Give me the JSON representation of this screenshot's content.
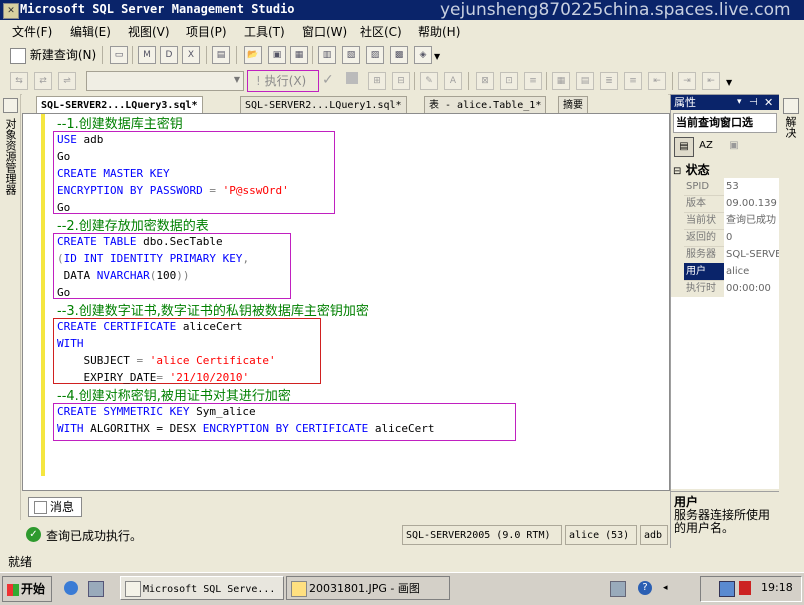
{
  "window": {
    "title": "Microsoft SQL Server Management Studio",
    "watermark": "yejunsheng870225china.spaces.live.com"
  },
  "menu": [
    "文件(F)",
    "编辑(E)",
    "视图(V)",
    "项目(P)",
    "工具(T)",
    "窗口(W)",
    "社区(C)",
    "帮助(H)"
  ],
  "toolbar": {
    "new_query_label": "新建查询(N)",
    "execute_label": "执行(X)"
  },
  "object_explorer_label": "对象资源管理器",
  "tabs": [
    {
      "label": "SQL-SERVER2...LQuery3.sql*"
    },
    {
      "label": "SQL-SERVER2...LQuery1.sql*"
    },
    {
      "label": "表 - alice.Table_1*"
    },
    {
      "label": "摘要"
    }
  ],
  "code": {
    "c1": "--1.创建数据库主密钥",
    "l1a": "USE",
    "l1b": " adb",
    "l2": "Go",
    "l3a": "CREATE MASTER KEY",
    "l4a": "ENCRYPTION BY PASSWORD",
    "l4b": " = ",
    "l4c": "'P@sswOrd'",
    "l5": "Go",
    "c2": "--2.创建存放加密数据的表",
    "l6a": "CREATE TABLE",
    "l6b": " dbo.SecTable",
    "l7a": "(",
    "l7b": "ID INT IDENTITY PRIMARY KEY",
    "l7c": ",",
    "l8a": " DATA ",
    "l8b": "NVARCHAR",
    "l8c": "(",
    "l8d": "100",
    "l8e": "))",
    "l9": "Go",
    "c3": "--3.创建数字证书,数字证书的私钥被数据库主密钥加密",
    "l10a": "CREATE CERTIFICATE",
    "l10b": " aliceCert",
    "l11": "WITH",
    "l12a": "    SUBJECT",
    "l12b": " = ",
    "l12c": "'alice Certificate'",
    "l13a": "    EXPIRY_DATE",
    "l13b": "= ",
    "l13c": "'21/10/2010'",
    "c4": "--4.创建对称密钥,被用证书对其进行加密",
    "l14a": "CREATE SYMMETRIC KEY",
    "l14b": " Sym_alice",
    "l15a": "WITH",
    "l15b": " ALGORITHX = DESX ",
    "l15c": "ENCRYPTION BY CERTIFICATE",
    "l15d": " aliceCert"
  },
  "messages_tab": "消息",
  "query_status": {
    "message": "查询已成功执行。",
    "server": "SQL-SERVER2005 (9.0 RTM)",
    "user": "alice (53)",
    "db": "adb"
  },
  "properties": {
    "title": "属性",
    "dropdown": "当前查询窗口选",
    "section": "状态",
    "rows": [
      {
        "name": "SPID",
        "value": "53"
      },
      {
        "name": "版本",
        "value": "09.00.139"
      },
      {
        "name": "当前状",
        "value": "查询已成功"
      },
      {
        "name": "返回的",
        "value": "0"
      },
      {
        "name": "服务器",
        "value": "SQL-SERVE"
      },
      {
        "name": "用户",
        "value": "alice"
      },
      {
        "name": "执行时",
        "value": "00:00:00"
      }
    ],
    "desc_title": "用户",
    "desc_text": "服务器连接所使用的用户名。"
  },
  "solution_strip": "解决",
  "app_status": "就绪",
  "taskbar": {
    "start": "开始",
    "tasks": [
      "Microsoft SQL Serve...",
      "20031801.JPG - 画图"
    ],
    "clock": "19:18"
  }
}
